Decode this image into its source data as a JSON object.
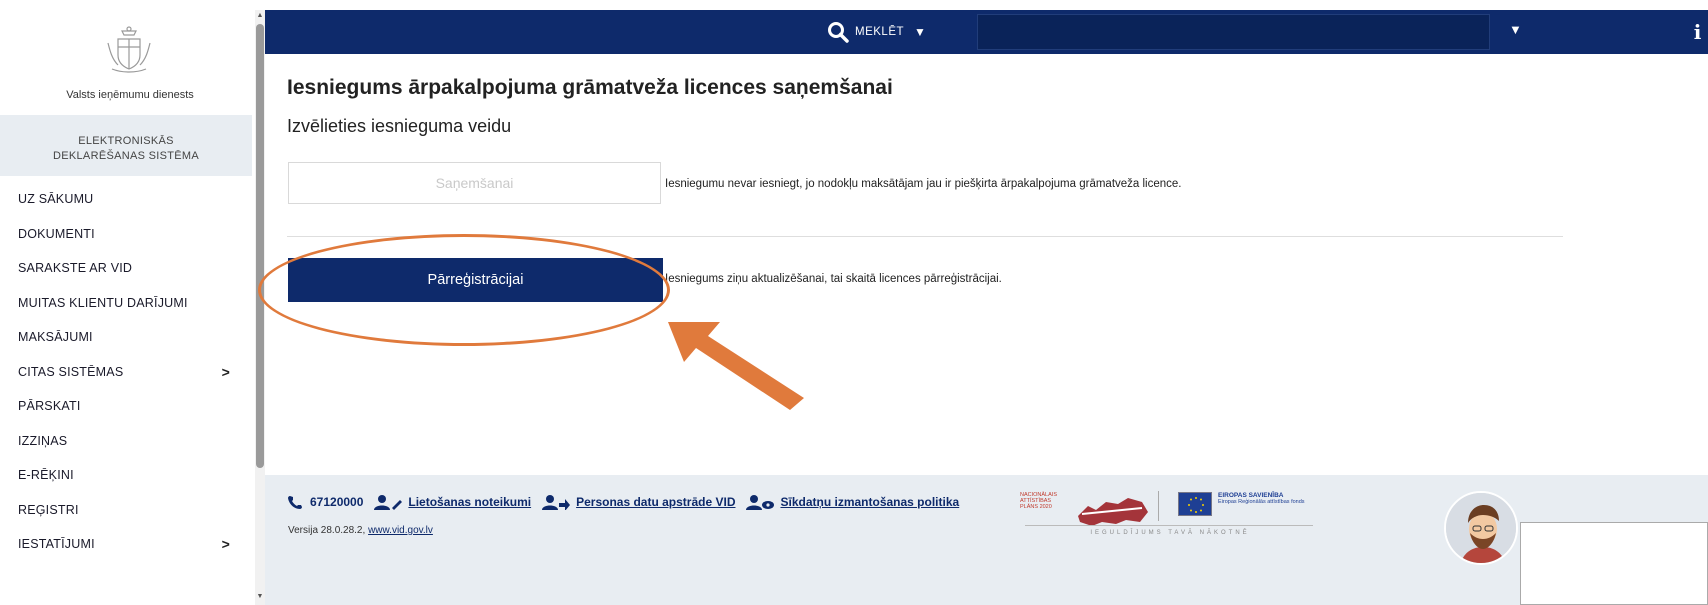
{
  "sidebar": {
    "agency_name": "Valsts ieņēmumu dienests",
    "system_line1": "ELEKTRONISKĀS",
    "system_line2": "DEKLARĒŠANAS SISTĒMA",
    "items": [
      {
        "label": "UZ SĀKUMU"
      },
      {
        "label": "DOKUMENTI"
      },
      {
        "label": "SARAKSTE AR VID"
      },
      {
        "label": "MUITAS KLIENTU DARĪJUMI"
      },
      {
        "label": "MAKSĀJUMI"
      },
      {
        "label": "CITAS SISTĒMAS",
        "chevron": ">"
      },
      {
        "label": "PĀRSKATI"
      },
      {
        "label": "IZZIŅAS"
      },
      {
        "label": "E-RĒĶINI"
      },
      {
        "label": "REĢISTRI"
      },
      {
        "label": "IESTATĪJUMI",
        "chevron": ">"
      }
    ]
  },
  "topbar": {
    "search_label": "MEKLĒT",
    "info_label": "i",
    "bg_color": "#0e2a6b"
  },
  "main": {
    "title": "Iesniegums ārpakalpojuma grāmatveža licences saņemšanai",
    "subtitle": "Izvēlieties iesnieguma veidu",
    "option1": {
      "button_label": "Saņemšanai",
      "description": "Iesniegumu nevar iesniegt, jo nodokļu maksātājam jau ir piešķirta ārpakalpojuma grāmatveža licence."
    },
    "option2": {
      "button_label": "Pārreģistrācijai",
      "description": "Iesniegums ziņu aktualizēšanai, tai skaitā licences pārreģistrācijai."
    }
  },
  "annotation": {
    "color": "#e07a3c"
  },
  "footer": {
    "phone": "67120000",
    "link_terms": "Lietošanas noteikumi",
    "link_privacy": "Personas datu apstrāde VID",
    "link_cookies": "Sīkdatņu izmantošanas politika",
    "version_text": "Versija 28.0.28.2,",
    "version_link": "www.vid.gov.lv",
    "nap_text": "NACIONĀLAIS ATTĪSTĪBAS PLĀNS 2020",
    "eu_title": "EIROPAS SAVIENĪBA",
    "eu_fund": "Eiropas Reģionālās attīstības fonds",
    "eu_slogan": "IEGULDĪJUMS TAVĀ NĀKOTNĒ"
  }
}
